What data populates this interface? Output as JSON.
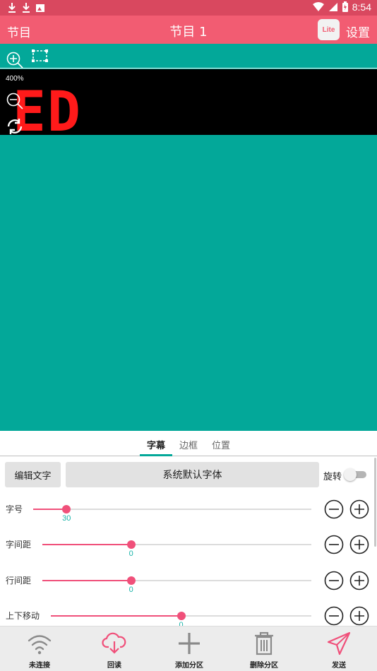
{
  "status_bar": {
    "time": "8:54",
    "left_icons": [
      "download-icon",
      "download-icon",
      "image-icon"
    ],
    "right_icons": [
      "wifi-icon",
      "signal-icon",
      "battery-icon"
    ],
    "color": "#d9485f"
  },
  "title_bar": {
    "left_title": "节目",
    "center_title": "节目 1",
    "lite_label": "Lite",
    "settings_label": "设置",
    "color": "#f25c72"
  },
  "canvas": {
    "background": "#03a899",
    "zoom_level": "400%",
    "preview_text": "ED",
    "preview_text_color": "#ff1a1a",
    "tools": [
      "zoom-in-icon",
      "select-area-icon",
      "zoom-out-icon",
      "refresh-icon"
    ]
  },
  "tabs": [
    {
      "label": "字幕",
      "active": true
    },
    {
      "label": "边框",
      "active": false
    },
    {
      "label": "位置",
      "active": false
    }
  ],
  "controls": {
    "edit_text_label": "编辑文字",
    "font_label": "系统默认字体",
    "rotate_label": "旋转",
    "rotate_on": false,
    "sliders": [
      {
        "label": "字号",
        "value": "30",
        "fraction": 0.12
      },
      {
        "label": "字间距",
        "value": "0",
        "fraction": 0.33
      },
      {
        "label": "行间距",
        "value": "0",
        "fraction": 0.33
      },
      {
        "label": "上下移动",
        "value": "0",
        "fraction": 0.5
      }
    ]
  },
  "bottom_nav": [
    {
      "label": "未连接",
      "icon": "wifi-icon",
      "color": "#8a8a8a"
    },
    {
      "label": "回读",
      "icon": "cloud-download-icon",
      "color": "#f0507a"
    },
    {
      "label": "添加分区",
      "icon": "plus-icon",
      "color": "#8a8a8a"
    },
    {
      "label": "删除分区",
      "icon": "trash-icon",
      "color": "#8a8a8a"
    },
    {
      "label": "发送",
      "icon": "send-icon",
      "color": "#f0507a"
    }
  ],
  "accent_color": "#f0507a"
}
